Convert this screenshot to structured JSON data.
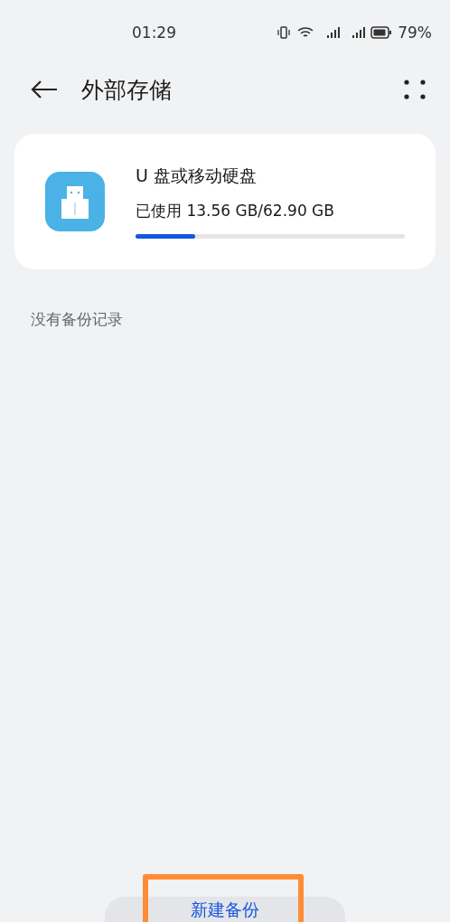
{
  "status_bar": {
    "time": "01:29",
    "battery": "79%"
  },
  "header": {
    "title": "外部存储"
  },
  "device": {
    "name": "U 盘或移动硬盘",
    "usage": "已使用 13.56 GB/62.90 GB",
    "level": 0.22
  },
  "empty_message": "没有备份记录",
  "button": {
    "label": "新建备份",
    "highlighted": true
  }
}
